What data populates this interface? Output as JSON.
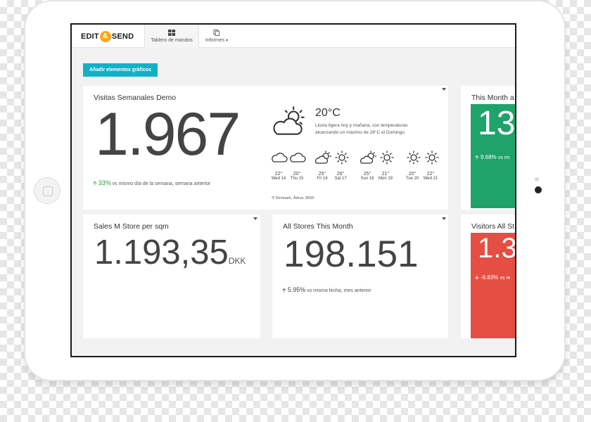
{
  "app": {
    "logo_left": "EDIT",
    "logo_amp": "&",
    "logo_right": "SEND"
  },
  "nav": {
    "tabs": [
      {
        "label": "Tablero de mandos",
        "icon": "windows-icon",
        "active": true
      },
      {
        "label": "Informes",
        "icon": "documents-icon",
        "active": false,
        "dropdown": true
      }
    ]
  },
  "toolbar": {
    "add_label": "Añadir elementos gráficos"
  },
  "cards": {
    "weekly": {
      "title": "Visitas Semanales Demo",
      "value": "1.967",
      "trend_pct": "33%",
      "trend_text": "vs mismo día de la semana, semana anterior"
    },
    "weather": {
      "temp": "20°C",
      "description": "Lluvia ligera hoy y mañana, con temperaturas alcanzando un máximo de 26°C el Domingo.",
      "location": "Denmark, Århus, 8000",
      "forecast": [
        {
          "temp": "22°",
          "day": "Wed 14",
          "icon": "cloud-icon"
        },
        {
          "temp": "20°",
          "day": "Thu 15",
          "icon": "cloud-icon"
        },
        {
          "temp": "25°",
          "day": "Fri 16",
          "icon": "partly-cloudy-icon"
        },
        {
          "temp": "26°",
          "day": "Sat 17",
          "icon": "sun-icon"
        },
        {
          "temp": "25°",
          "day": "Sun 18",
          "icon": "partly-cloudy-icon"
        },
        {
          "temp": "21°",
          "day": "Mon 19",
          "icon": "sun-icon"
        },
        {
          "temp": "20°",
          "day": "Tue 20",
          "icon": "sun-icon"
        },
        {
          "temp": "22°",
          "day": "Wed 21",
          "icon": "sun-icon"
        }
      ]
    },
    "this_month": {
      "title": "This Month a",
      "value": "13",
      "trend_pct": "9.68%",
      "trend_text": "vs mi"
    },
    "sales": {
      "title": "Sales M Store per sqm",
      "value": "1.193,35",
      "unit": "DKK"
    },
    "all_stores": {
      "title": "All Stores This Month",
      "value": "198.151",
      "trend_pct": "5.95%",
      "trend_text": "vs misma fecha, mes anterior"
    },
    "visitors": {
      "title": "Visitors All St",
      "value": "1.3",
      "trend_pct": "-8.83%",
      "trend_text": "vs m"
    }
  },
  "colors": {
    "accent": "#13b1c8",
    "green": "#1fa36a",
    "red": "#e54e42",
    "logo_orange": "#f5a81c",
    "positive": "#27a04a"
  }
}
